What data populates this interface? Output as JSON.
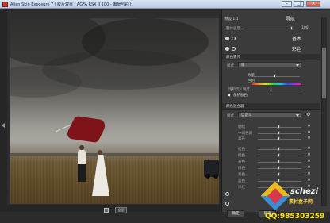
{
  "window": {
    "title": "Alien Skin Exposure 7 | 胶片效果 | AGFA RSX II 100 - 偏暖与彩上",
    "minimize": "–",
    "maximize": "□",
    "close": "✕"
  },
  "toolbar": {
    "zoom_button": "全图"
  },
  "panel": {
    "preset_label": "预设 1.1",
    "preset_name": "导航",
    "overall_label": "整体强度",
    "overall_value": "100",
    "section_basic": "基本",
    "section_color": "彩色",
    "tone_header": "颜色遗传",
    "select_label": "样式",
    "select_value": "暖",
    "amount_label": "数量",
    "hue_label": "色相",
    "saturation_label": "饱和度 / 明度",
    "preserve_label": "保护肤色",
    "channel_header": "颜色混合器",
    "style_label": "样式",
    "style_value": "自定义",
    "mixer_rows": [
      {
        "label": "明暗",
        "value": "0"
      },
      {
        "label": "中间色调",
        "value": "0"
      },
      {
        "label": "高光",
        "value": "0"
      },
      {
        "label": "红色",
        "value": "0"
      },
      {
        "label": "橙色",
        "value": "0"
      },
      {
        "label": "黄色",
        "value": "0"
      },
      {
        "label": "绿色",
        "value": "0"
      },
      {
        "label": "青色",
        "value": "0"
      },
      {
        "label": "蓝色",
        "value": "0"
      },
      {
        "label": "洋红",
        "value": "0"
      }
    ],
    "ok_button": "确定",
    "cancel_button": "取消"
  },
  "watermark": {
    "brand": "schezi",
    "sub": "素材盒子网",
    "qq": "QQ:985303259"
  },
  "icons": [
    "app-icon",
    "zoom-icon",
    "collapse-arrow-icon",
    "radio-icon",
    "gear-icon"
  ]
}
